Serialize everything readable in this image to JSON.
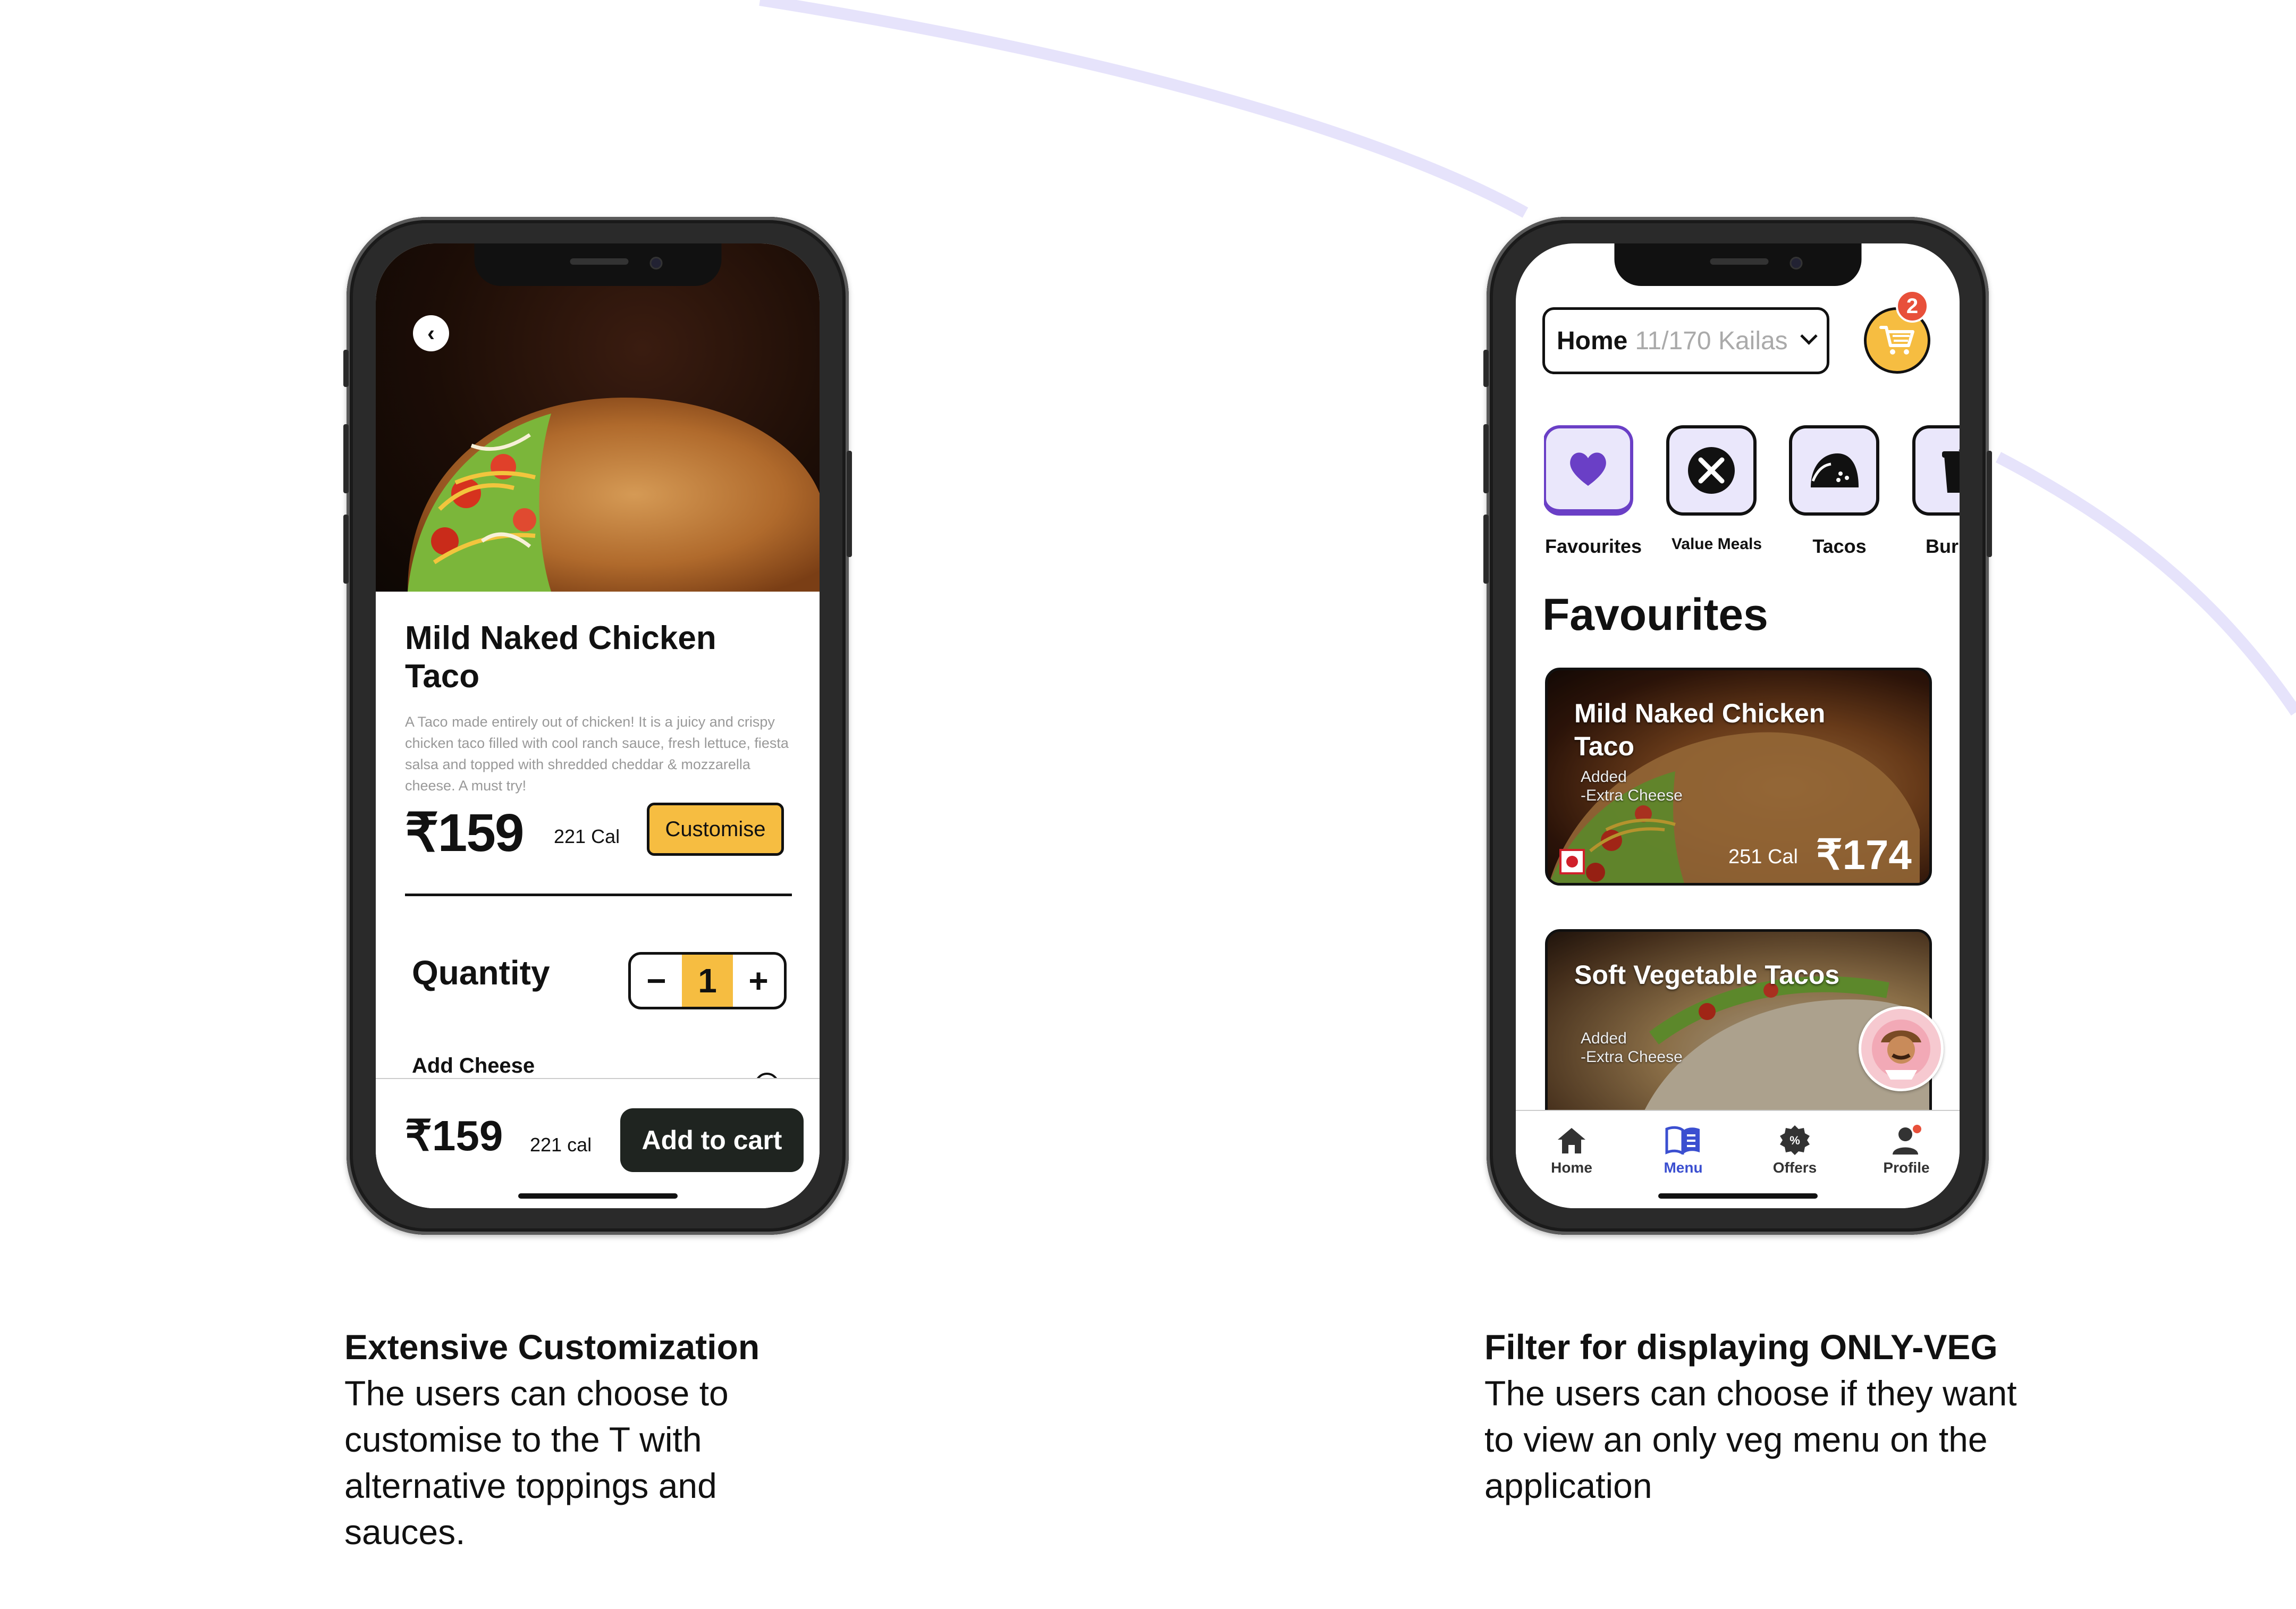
{
  "colors": {
    "accent_yellow": "#f6bd41",
    "purple_active": "#6a3fc6",
    "menu_blue": "#3b4fd0",
    "badge_red": "#e8503a",
    "arc_lavender": "#e6e3fb"
  },
  "product_detail": {
    "title": "Mild Naked Chicken Taco",
    "description": "A Taco made entirely out of chicken! It is a juicy and crispy chicken taco filled with cool ranch sauce, fresh lettuce, fiesta salsa and topped with shredded cheddar & mozzarella cheese. A must try!",
    "price": "₹159",
    "calories": "221 Cal",
    "customise_label": "Customise",
    "quantity_label": "Quantity",
    "quantity_value": "1",
    "minus": "−",
    "plus": "+",
    "option_label": "Add Cheese",
    "footer_price": "₹159",
    "footer_calories": "221 cal",
    "add_to_cart_label": "Add to cart",
    "back_icon": "chevron-left-icon"
  },
  "menu_screen": {
    "address_title": "Home",
    "address_sub": "11/170 Kailas",
    "cart_count": "2",
    "categories": [
      {
        "label": "Favourites",
        "icon": "heart-icon"
      },
      {
        "label": "Value Meals",
        "icon": "fork-knife-icon"
      },
      {
        "label": "Tacos",
        "icon": "taco-icon"
      },
      {
        "label": "Burritos",
        "icon": "cup-icon"
      }
    ],
    "section_title": "Favourites",
    "cards": [
      {
        "title": "Mild Naked Chicken Taco",
        "added_label": "Added",
        "added_item": "-Extra Cheese",
        "calories": "251 Cal",
        "price": "₹174",
        "diet": "non-veg"
      },
      {
        "title": "Soft Vegetable Tacos",
        "added_label": "Added",
        "added_item": "-Extra Cheese"
      }
    ],
    "tabs": [
      {
        "label": "Home",
        "icon": "home-icon"
      },
      {
        "label": "Menu",
        "icon": "menu-book-icon",
        "active": true
      },
      {
        "label": "Offers",
        "icon": "offers-badge-icon"
      },
      {
        "label": "Profile",
        "icon": "profile-icon"
      }
    ]
  },
  "captions": [
    {
      "title": "Extensive Customization",
      "body": "The users can choose to customise to the T with alternative toppings and sauces."
    },
    {
      "title": "Filter for displaying ONLY-VEG",
      "body": "The users can choose if they want to view an only veg menu on the application"
    }
  ]
}
